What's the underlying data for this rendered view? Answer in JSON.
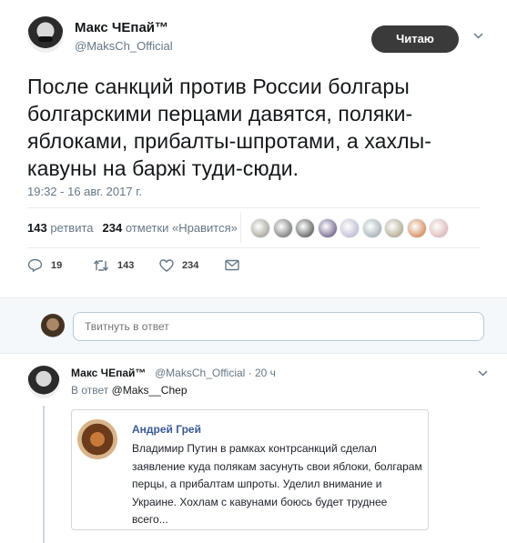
{
  "tweet": {
    "author_name": "Макс ЧЕпай™",
    "author_handle": "@MaksCh_Official",
    "follow_label": "Читаю",
    "caret": "⌄",
    "text": "После санкций против России болгары болгарскими перцами давятся, поляки-яблоками, прибалты-шпротами, а хахлы-кавуны на баржі туди-сюди.",
    "timestamp": "19:32 - 16 авг. 2017 г.",
    "retweets_count": "143",
    "retweets_label": "ретвита",
    "likes_count": "234",
    "likes_label": "отметки «Нравится»",
    "liker_colors": [
      "#8b8b7a",
      "#555555",
      "#333333",
      "#4a3a6a",
      "#aaa9c2",
      "#8a9aa0",
      "#9c8f6e",
      "#c66a2c",
      "#d4a0a0"
    ],
    "actions": {
      "replies": "19",
      "retweets": "143",
      "likes": "234"
    }
  },
  "reply_box": {
    "placeholder": "Твитнуть в ответ"
  },
  "reply": {
    "author_name": "Макс ЧЕпай™",
    "meta": "@MaksCh_Official · 20 ч",
    "in_reply_prefix": "В ответ",
    "in_reply_handle": "@Maks__Chep",
    "quote": {
      "name": "Андрей Грей",
      "text": "Владимир Путин в рамках контрсанкций сделал заявление куда полякам засунуть свои яблоки, болгарам перцы, а прибалтам шпроты. Уделил внимание и Украине. Хохлам с кавунами боюсь будет труднее всего..."
    }
  },
  "colors": {
    "accent_link": "#3b5998",
    "follow_button": "#3a3a3a",
    "muted": "#657786"
  }
}
